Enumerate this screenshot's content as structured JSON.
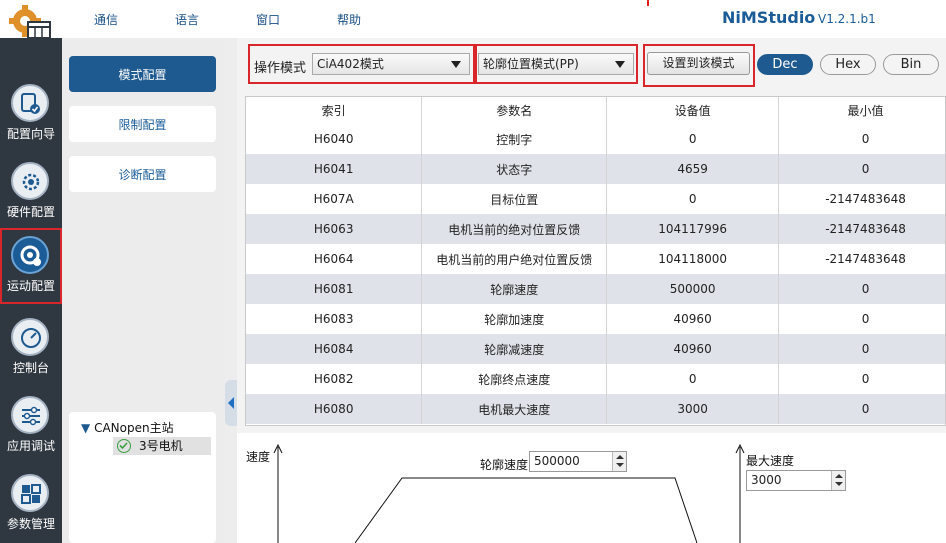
{
  "menu": {
    "items": [
      "通信",
      "语言",
      "窗口",
      "帮助"
    ],
    "app_name": "NiMStudio",
    "version": "V1.2.1.b1"
  },
  "sidebar": {
    "items": [
      {
        "label": "配置向导",
        "icon": "wizard-icon"
      },
      {
        "label": "硬件配置",
        "icon": "hardware-gear-icon"
      },
      {
        "label": "运动配置",
        "icon": "motion-config-icon"
      },
      {
        "label": "控制台",
        "icon": "gauge-icon"
      },
      {
        "label": "应用调试",
        "icon": "sliders-icon"
      },
      {
        "label": "参数管理",
        "icon": "param-grid-icon"
      }
    ]
  },
  "nav": {
    "buttons": [
      "模式配置",
      "限制配置",
      "诊断配置"
    ]
  },
  "tree": {
    "root": "CANopen主站",
    "child": "3号电机"
  },
  "toolbar": {
    "op_mode_label": "操作模式",
    "op_mode_value": "CiA402模式",
    "sub_mode_value": "轮廓位置模式(PP)",
    "set_button": "设置到该模式",
    "radix": [
      "Dec",
      "Hex",
      "Bin"
    ]
  },
  "table": {
    "headers": [
      "索引",
      "参数名",
      "设备值",
      "最小值"
    ],
    "rows": [
      [
        "H6040",
        "控制字",
        "0",
        "0"
      ],
      [
        "H6041",
        "状态字",
        "4659",
        "0"
      ],
      [
        "H607A",
        "目标位置",
        "0",
        "-2147483648"
      ],
      [
        "H6063",
        "电机当前的绝对位置反馈",
        "104117996",
        "-2147483648"
      ],
      [
        "H6064",
        "电机当前的用户绝对位置反馈",
        "104118000",
        "-2147483648"
      ],
      [
        "H6081",
        "轮廓速度",
        "500000",
        "0"
      ],
      [
        "H6083",
        "轮廓加速度",
        "40960",
        "0"
      ],
      [
        "H6084",
        "轮廓减速度",
        "40960",
        "0"
      ],
      [
        "H6082",
        "轮廓终点速度",
        "0",
        "0"
      ],
      [
        "H6080",
        "电机最大速度",
        "3000",
        "0"
      ]
    ]
  },
  "diagram": {
    "speed_axis_label": "速度",
    "profile_speed_label": "轮廓速度",
    "profile_speed_value": "500000",
    "max_speed_label": "最大速度",
    "max_speed_value": "3000"
  },
  "colors": {
    "accent": "#1e5a8f",
    "highlight": "#d9262a",
    "row_alt": "#dfe3e9"
  }
}
